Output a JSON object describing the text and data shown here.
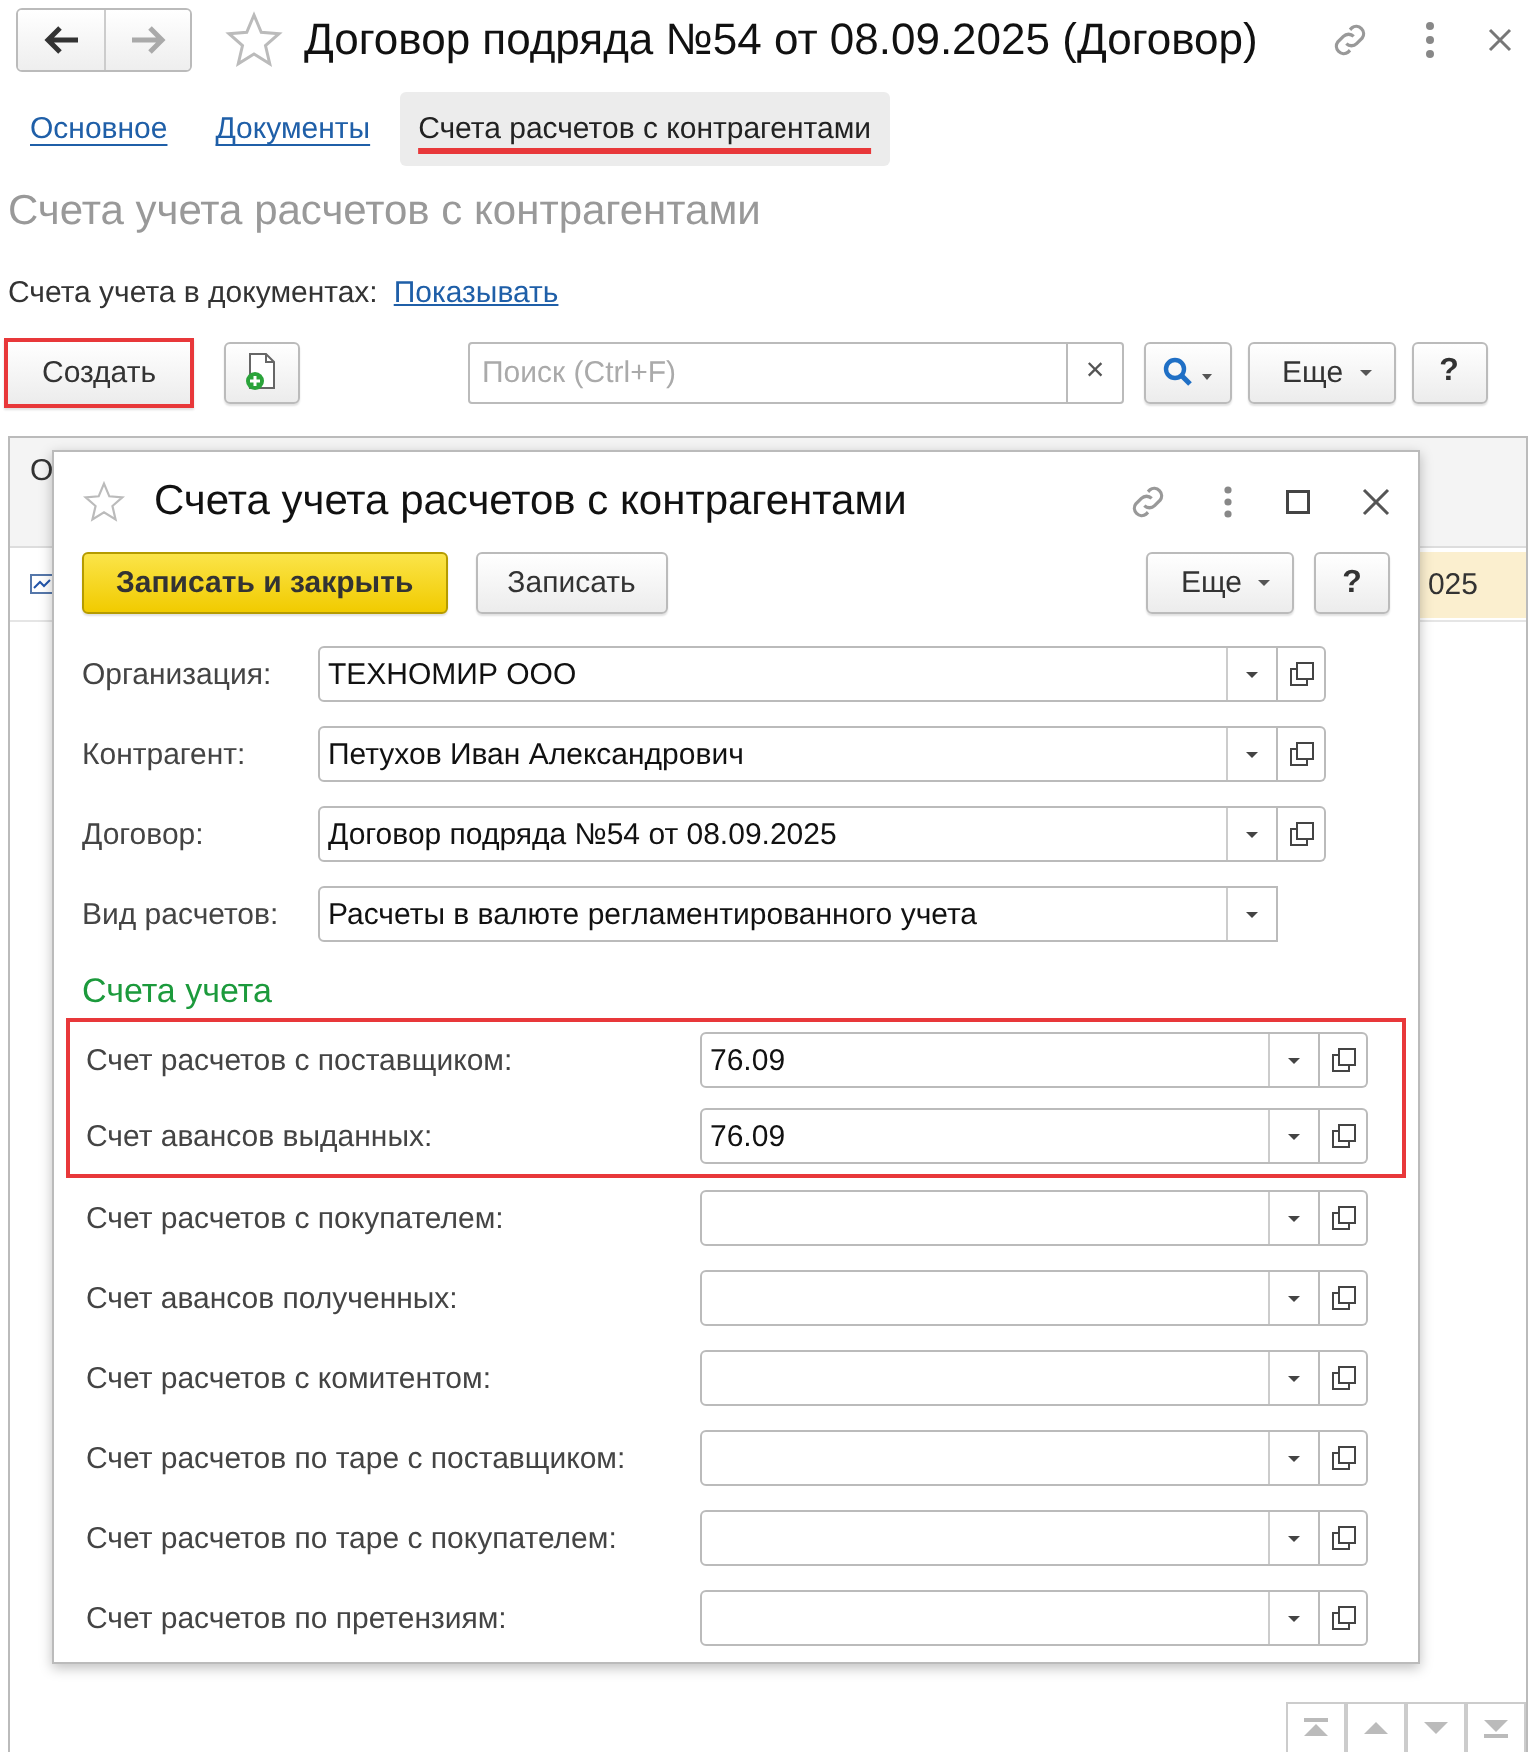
{
  "window": {
    "title": "Договор подряда №54 от 08.09.2025 (Договор)"
  },
  "tabs": [
    {
      "label": "Основное",
      "selected": false,
      "highlighted": false
    },
    {
      "label": "Документы",
      "selected": false,
      "highlighted": false
    },
    {
      "label": "Счета расчетов с контрагентами",
      "selected": true,
      "highlighted": true
    }
  ],
  "section_title": "Счета учета расчетов с контрагентами",
  "accounts_in_documents": {
    "label": "Счета учета в документах:",
    "link": "Показывать"
  },
  "toolbar": {
    "create_button": {
      "label": "Создать",
      "highlighted": true
    },
    "search": {
      "placeholder": "Поиск (Ctrl+F)"
    },
    "clear": "×",
    "more": "Еще",
    "help": "?"
  },
  "table": {
    "columns": [
      "О"
    ],
    "rows": [
      {
        "column_3": "025"
      }
    ]
  },
  "dialog": {
    "title": "Счета учета расчетов с контрагентами",
    "buttons": {
      "save_and_close": "Записать и закрыть",
      "save": "Записать",
      "more": "Еще",
      "help": "?"
    },
    "fields": [
      {
        "label": "Организация:",
        "value": "ТЕХНОМИР ООО",
        "open_button": true
      },
      {
        "label": "Контрагент:",
        "value": "Петухов Иван Александрович",
        "open_button": true
      },
      {
        "label": "Договор:",
        "value": "Договор подряда №54 от 08.09.2025",
        "open_button": true
      },
      {
        "label": "Вид расчетов:",
        "value": "Расчеты в валюте регламентированного учета",
        "open_button": false
      }
    ],
    "section": "Счета учета",
    "accounts": [
      {
        "label": "Счет расчетов с поставщиком:",
        "value": "76.09",
        "highlighted": true
      },
      {
        "label": "Счет авансов выданных:",
        "value": "76.09",
        "highlighted": true
      },
      {
        "label": "Счет расчетов с покупателем:",
        "highlighted": false
      },
      {
        "label": "Счет авансов полученных:",
        "highlighted": false
      },
      {
        "label": "Счет расчетов с комитентом:",
        "highlighted": false
      },
      {
        "label": "Счет расчетов по таре с поставщиком:",
        "highlighted": false
      },
      {
        "label": "Счет расчетов по таре с покупателем:",
        "highlighted": false
      },
      {
        "label": "Счет расчетов по претензиям:",
        "highlighted": false
      }
    ]
  }
}
